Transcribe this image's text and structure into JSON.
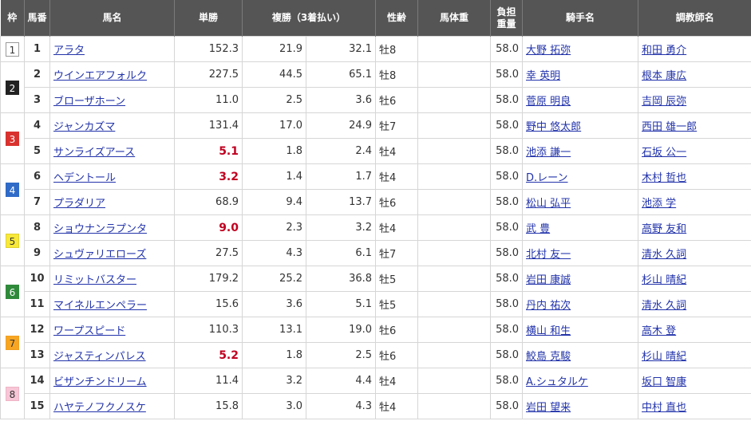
{
  "colors": {
    "header_bg": "#555555",
    "link": "#2233aa",
    "favorite_odds": "#c00020",
    "grid": "#d6d6d6"
  },
  "headers": {
    "waku": "枠",
    "umaban": "馬番",
    "horse": "馬名",
    "win": "単勝",
    "place": "複勝（3着払い）",
    "sexage": "性齢",
    "bodyweight": "馬体重",
    "burden_line1": "負担",
    "burden_line2": "重量",
    "jockey": "騎手名",
    "trainer": "調教師名"
  },
  "waku_colors": {
    "1": {
      "bg": "#ffffff",
      "fg": "#333333",
      "border": "#999999"
    },
    "2": {
      "bg": "#222222",
      "fg": "#ffffff",
      "border": "#222222"
    },
    "3": {
      "bg": "#d9322e",
      "fg": "#ffffff",
      "border": "#d9322e"
    },
    "4": {
      "bg": "#2f6bc7",
      "fg": "#ffffff",
      "border": "#2f6bc7"
    },
    "5": {
      "bg": "#f7e83a",
      "fg": "#333333",
      "border": "#e0d030"
    },
    "6": {
      "bg": "#2f8a3a",
      "fg": "#ffffff",
      "border": "#2f8a3a"
    },
    "7": {
      "bg": "#f7a623",
      "fg": "#333333",
      "border": "#f0a020"
    },
    "8": {
      "bg": "#f7c6d6",
      "fg": "#333333",
      "border": "#efb4c6"
    }
  },
  "rows": [
    {
      "waku": "1",
      "umaban": "1",
      "horse": "アラタ",
      "win": "152.3",
      "hot": false,
      "place_min": "21.9",
      "place_max": "32.1",
      "sexage": "牡8",
      "bodyweight": "",
      "burden": "58.0",
      "jockey": "大野 拓弥",
      "trainer": "和田 勇介"
    },
    {
      "waku": "2",
      "umaban": "2",
      "horse": "ウインエアフォルク",
      "win": "227.5",
      "hot": false,
      "place_min": "44.5",
      "place_max": "65.1",
      "sexage": "牡8",
      "bodyweight": "",
      "burden": "58.0",
      "jockey": "幸 英明",
      "trainer": "根本 康広"
    },
    {
      "waku": "",
      "umaban": "3",
      "horse": "ブローザホーン",
      "win": "11.0",
      "hot": false,
      "place_min": "2.5",
      "place_max": "3.6",
      "sexage": "牡6",
      "bodyweight": "",
      "burden": "58.0",
      "jockey": "菅原 明良",
      "trainer": "吉岡 辰弥"
    },
    {
      "waku": "3",
      "umaban": "4",
      "horse": "ジャンカズマ",
      "win": "131.4",
      "hot": false,
      "place_min": "17.0",
      "place_max": "24.9",
      "sexage": "牡7",
      "bodyweight": "",
      "burden": "58.0",
      "jockey": "野中 悠太郎",
      "trainer": "西田 雄一郎"
    },
    {
      "waku": "",
      "umaban": "5",
      "horse": "サンライズアース",
      "win": "5.1",
      "hot": true,
      "place_min": "1.8",
      "place_max": "2.4",
      "sexage": "牡4",
      "bodyweight": "",
      "burden": "58.0",
      "jockey": "池添 謙一",
      "trainer": "石坂 公一"
    },
    {
      "waku": "4",
      "umaban": "6",
      "horse": "ヘデントール",
      "win": "3.2",
      "hot": true,
      "place_min": "1.4",
      "place_max": "1.7",
      "sexage": "牡4",
      "bodyweight": "",
      "burden": "58.0",
      "jockey": "D.レーン",
      "trainer": "木村 哲也"
    },
    {
      "waku": "",
      "umaban": "7",
      "horse": "プラダリア",
      "win": "68.9",
      "hot": false,
      "place_min": "9.4",
      "place_max": "13.7",
      "sexage": "牡6",
      "bodyweight": "",
      "burden": "58.0",
      "jockey": "松山 弘平",
      "trainer": "池添 学"
    },
    {
      "waku": "5",
      "umaban": "8",
      "horse": "ショウナンラプンタ",
      "win": "9.0",
      "hot": true,
      "place_min": "2.3",
      "place_max": "3.2",
      "sexage": "牡4",
      "bodyweight": "",
      "burden": "58.0",
      "jockey": "武 豊",
      "trainer": "高野 友和"
    },
    {
      "waku": "",
      "umaban": "9",
      "horse": "シュヴァリエローズ",
      "win": "27.5",
      "hot": false,
      "place_min": "4.3",
      "place_max": "6.1",
      "sexage": "牡7",
      "bodyweight": "",
      "burden": "58.0",
      "jockey": "北村 友一",
      "trainer": "清水 久詞"
    },
    {
      "waku": "6",
      "umaban": "10",
      "horse": "リミットバスター",
      "win": "179.2",
      "hot": false,
      "place_min": "25.2",
      "place_max": "36.8",
      "sexage": "牡5",
      "bodyweight": "",
      "burden": "58.0",
      "jockey": "岩田 康誠",
      "trainer": "杉山 晴紀"
    },
    {
      "waku": "",
      "umaban": "11",
      "horse": "マイネルエンペラー",
      "win": "15.6",
      "hot": false,
      "place_min": "3.6",
      "place_max": "5.1",
      "sexage": "牡5",
      "bodyweight": "",
      "burden": "58.0",
      "jockey": "丹内 祐次",
      "trainer": "清水 久詞"
    },
    {
      "waku": "7",
      "umaban": "12",
      "horse": "ワープスピード",
      "win": "110.3",
      "hot": false,
      "place_min": "13.1",
      "place_max": "19.0",
      "sexage": "牡6",
      "bodyweight": "",
      "burden": "58.0",
      "jockey": "横山 和生",
      "trainer": "高木 登"
    },
    {
      "waku": "",
      "umaban": "13",
      "horse": "ジャスティンパレス",
      "win": "5.2",
      "hot": true,
      "place_min": "1.8",
      "place_max": "2.5",
      "sexage": "牡6",
      "bodyweight": "",
      "burden": "58.0",
      "jockey": "鮫島 克駿",
      "trainer": "杉山 晴紀"
    },
    {
      "waku": "8",
      "umaban": "14",
      "horse": "ビザンチンドリーム",
      "win": "11.4",
      "hot": false,
      "place_min": "3.2",
      "place_max": "4.4",
      "sexage": "牡4",
      "bodyweight": "",
      "burden": "58.0",
      "jockey": "A.シュタルケ",
      "trainer": "坂口 智康"
    },
    {
      "waku": "",
      "umaban": "15",
      "horse": "ハヤテノフクノスケ",
      "win": "15.8",
      "hot": false,
      "place_min": "3.0",
      "place_max": "4.3",
      "sexage": "牡4",
      "bodyweight": "",
      "burden": "58.0",
      "jockey": "岩田 望来",
      "trainer": "中村 直也"
    }
  ]
}
